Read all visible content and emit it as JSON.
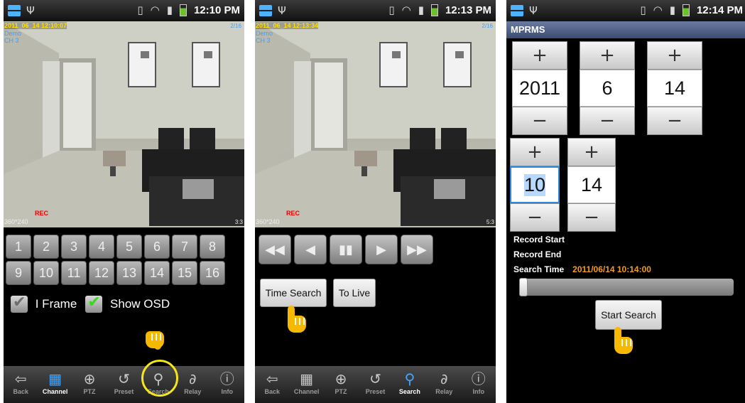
{
  "statusbar": {
    "times": [
      "12:10 PM",
      "12:13 PM",
      "12:14 PM"
    ],
    "icons": [
      "app-icon",
      "usb-icon",
      "vibrate-icon",
      "wifi-icon",
      "signal-icon",
      "battery-icon"
    ]
  },
  "live": {
    "timestamp": "2011_06_14 12:10:07",
    "site": "Demo",
    "channel": "CH 3",
    "corner": "2/16",
    "rec": "REC",
    "resolution": "360*240",
    "ratio": "3:3",
    "channels": [
      "1",
      "2",
      "3",
      "4",
      "5",
      "6",
      "7",
      "8",
      "9",
      "10",
      "11",
      "12",
      "13",
      "14",
      "15",
      "16"
    ],
    "iframe_label": "I Frame",
    "iframe_checked": false,
    "osd_label": "Show OSD",
    "osd_checked": true
  },
  "playback": {
    "timestamp": "2011_06_14 12:13:34",
    "site": "Demo",
    "channel": "CH 3",
    "corner": "2/16",
    "rec": "REC",
    "resolution": "360*240",
    "ratio": "5:3",
    "controls": [
      "fast-rewind-icon",
      "rewind-icon",
      "pause-icon",
      "play-icon",
      "fast-forward-icon"
    ],
    "time_search_label": "Time Search",
    "to_live_label": "To Live"
  },
  "nav": {
    "items": [
      {
        "label": "Back",
        "icon": "back-icon"
      },
      {
        "label": "Channel",
        "icon": "grid-icon"
      },
      {
        "label": "PTZ",
        "icon": "ptz-icon"
      },
      {
        "label": "Preset",
        "icon": "preset-icon"
      },
      {
        "label": "Search",
        "icon": "search-icon"
      },
      {
        "label": "Relay",
        "icon": "relay-icon"
      },
      {
        "label": "Info",
        "icon": "info-icon"
      }
    ],
    "active_screen1": "Channel",
    "active_screen2": "Search"
  },
  "search": {
    "title": "MPRMS",
    "year": "2011",
    "month": "6",
    "day": "14",
    "hour": "10",
    "minute": "14",
    "record_start_label": "Record Start",
    "record_end_label": "Record End",
    "search_time_label": "Search Time",
    "search_time_value": "2011/06/14 10:14:00",
    "slider_position": 0,
    "start_search_label": "Start Search",
    "plus": "+",
    "minus": "−"
  },
  "colors": {
    "accent_blue": "#43a7ff",
    "osd_yellow": "#ffe000",
    "highlight_circle": "#f4e61a",
    "hand": "#f7b800",
    "search_time": "#f39b1a"
  }
}
